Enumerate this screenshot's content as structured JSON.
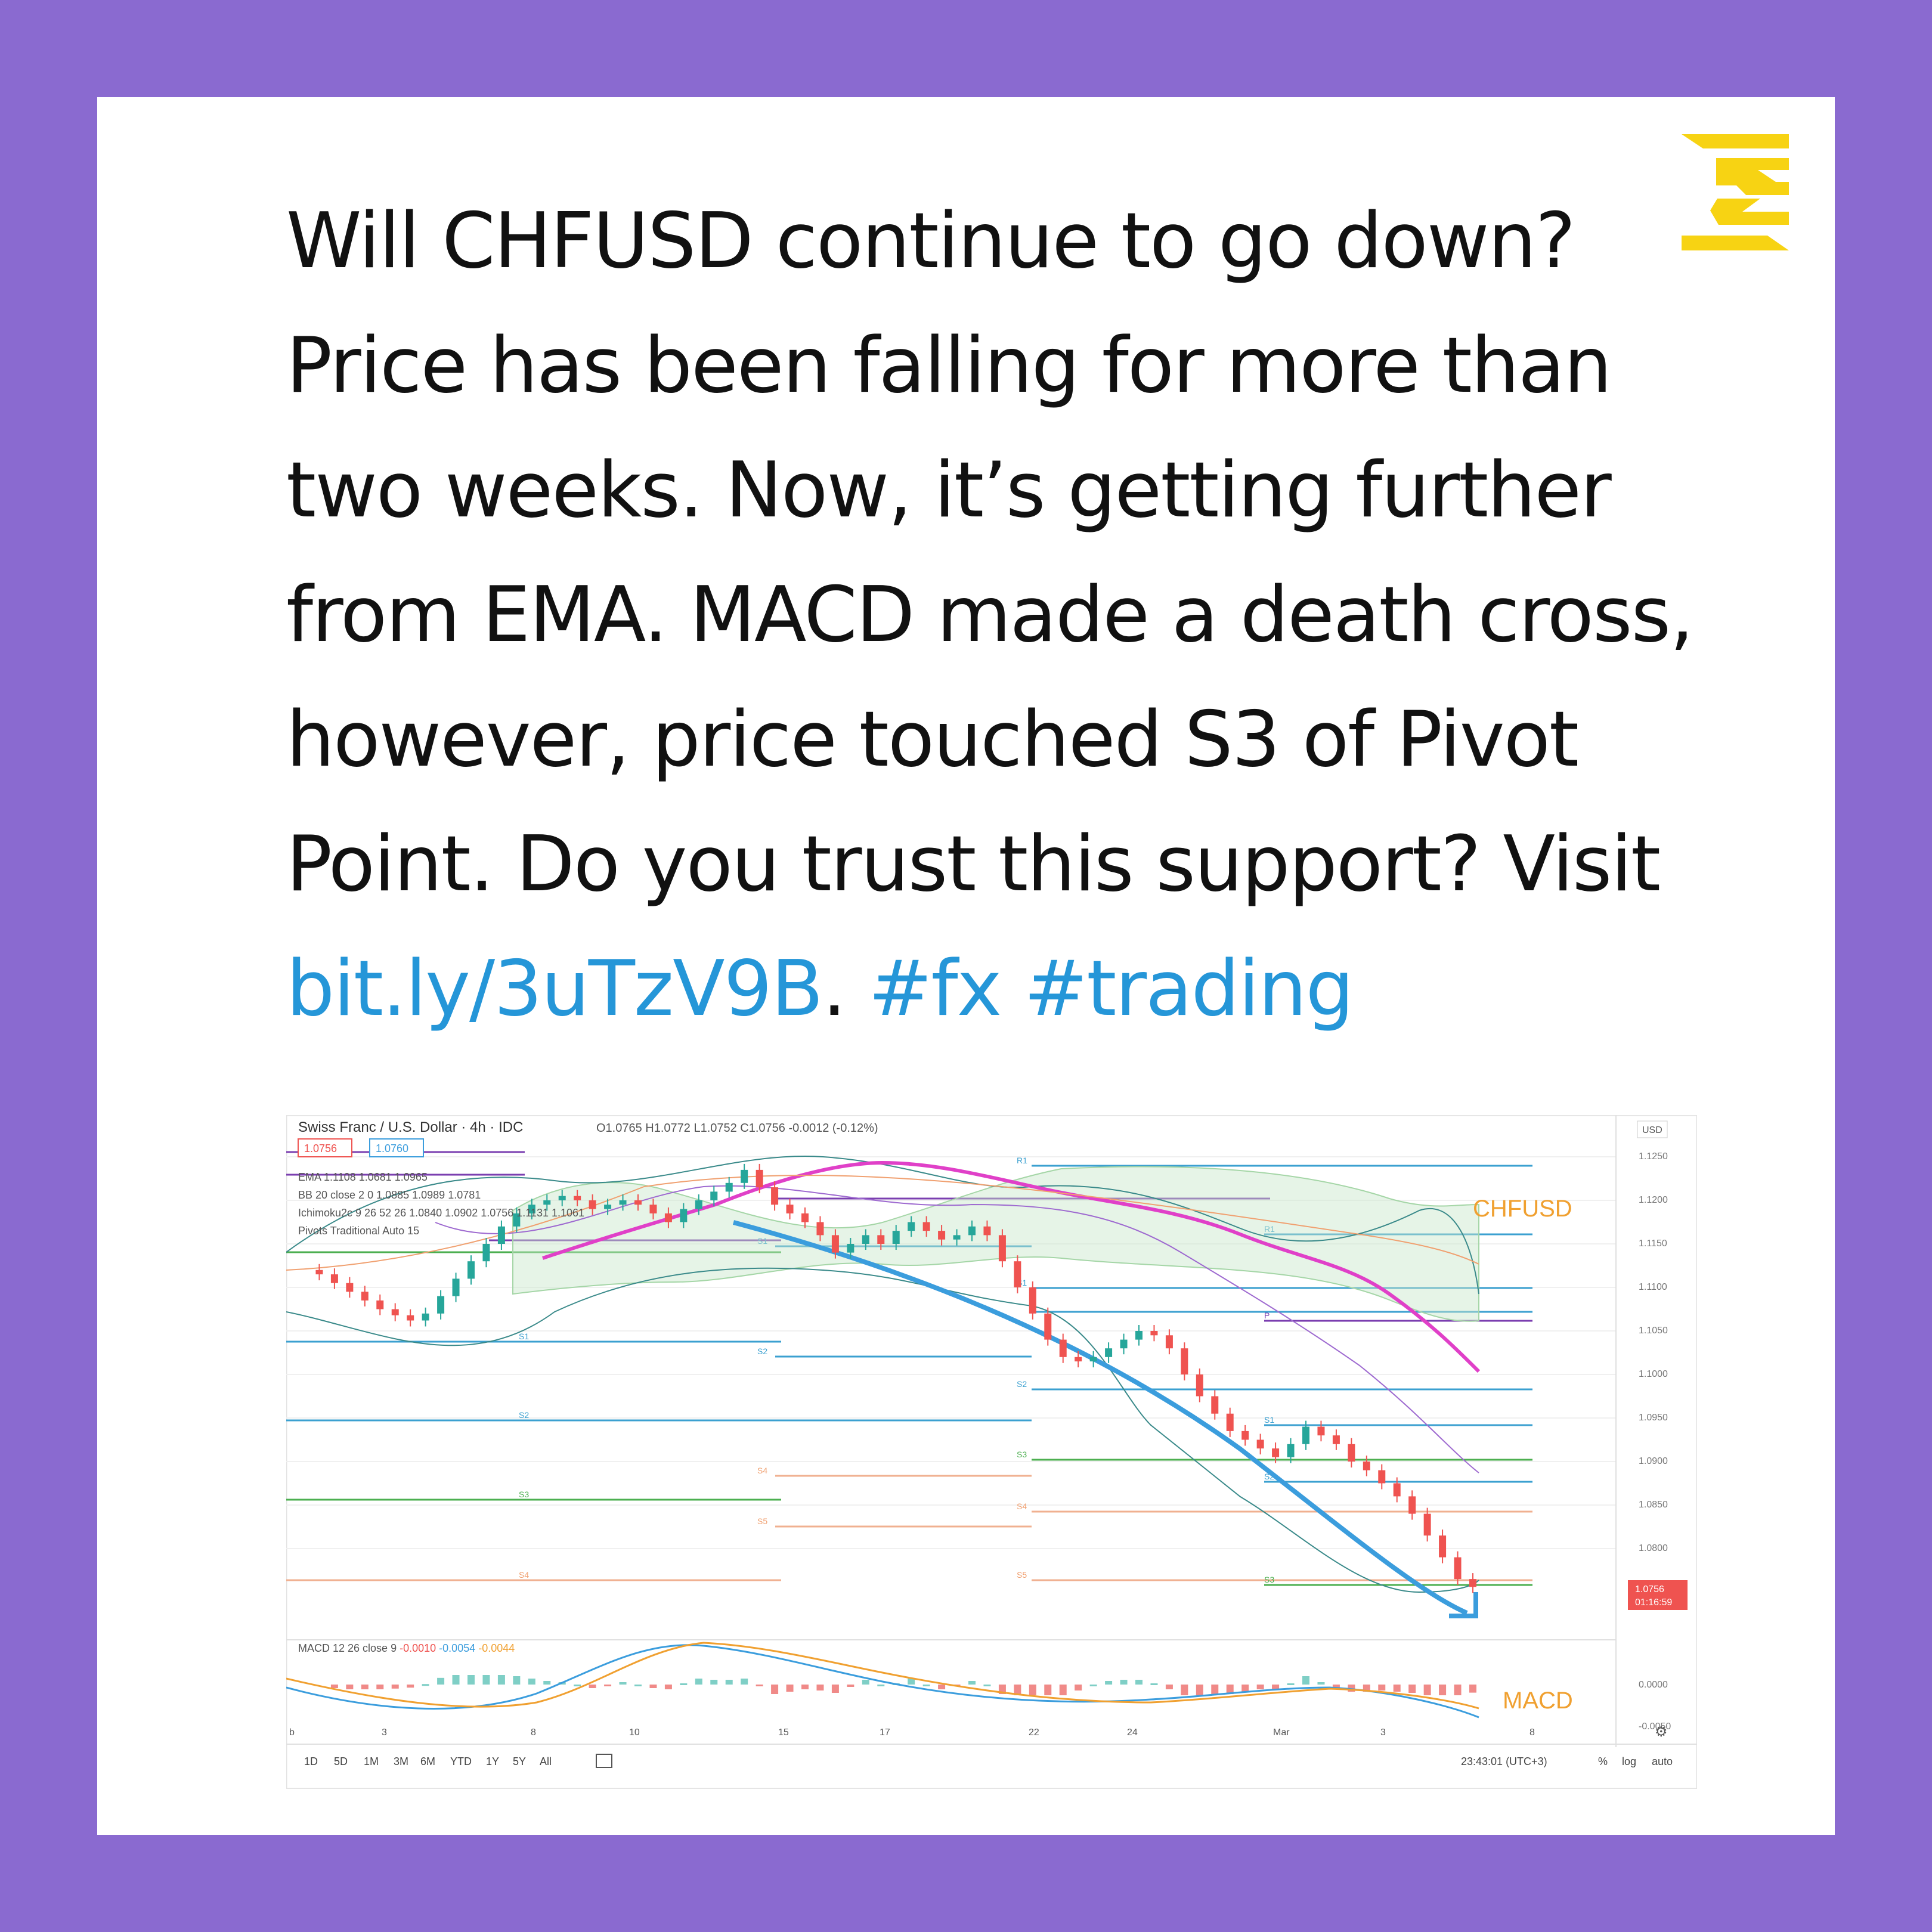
{
  "post": {
    "text_lines": [
      "Will CHFUSD continue to go down?",
      "Price has been falling for more than",
      "two weeks. Now, it’s getting further",
      "from EMA. MACD made a death cross,",
      "however, price touched S3 of Pivot",
      "Point. Do you trust this support? Visit"
    ],
    "link": "bit.ly/3uTzV9B",
    "after_link": ".",
    "hashtag_fx": "#fx",
    "hashtag_trading": "#trading"
  },
  "brand": {
    "logo_icon": "z-logo-icon",
    "accent": "#f7d313"
  },
  "colors": {
    "background": "#8a6ad0",
    "card": "#ffffff",
    "link": "#2596d8",
    "candle_up": "#26a69a",
    "candle_down": "#ef5350",
    "ema": "#e040c8",
    "trend_arrow": "#3b9ddd",
    "annotation": "#f0a030"
  },
  "chart": {
    "header": {
      "symbol": "Swiss Franc / U.S. Dollar",
      "interval": "4h",
      "source": "IDC",
      "ohlc": "O1.0765 H1.0772 L1.0752 C1.0756 -0.0012 (-0.12%)"
    },
    "price_box_left": "1.0756",
    "price_box_right": "1.0760",
    "indicators": [
      "EMA 1.1108 1.0681 1.0965",
      "BB 20 close 2 0 1.0885 1.0989 1.0781",
      "Ichimoku2c 9 26 52 26 1.0840 1.0902 1.0756 1.1131 1.1061",
      "Pivots Traditional Auto 15"
    ],
    "currency": "USD",
    "y_ticks": [
      "1.1250",
      "1.1200",
      "1.1150",
      "1.1100",
      "1.1050",
      "1.1000",
      "1.0950",
      "1.0900",
      "1.0850",
      "1.0800"
    ],
    "current_price": "1.0756",
    "countdown": "01:16:59",
    "annotation_price": "CHFUSD",
    "annotation_macd": "MACD",
    "macd_header": "MACD 12 26 close 9",
    "macd_hist": "-0.0010",
    "macd_line": "-0.0054",
    "macd_signal": "-0.0044",
    "macd_ticks": [
      "0.0000",
      "-0.0050"
    ],
    "x_ticks": [
      "b",
      "3",
      "8",
      "10",
      "15",
      "17",
      "22",
      "24",
      "Mar",
      "3",
      "8"
    ],
    "ranges": [
      "1D",
      "5D",
      "1M",
      "3M",
      "6M",
      "YTD",
      "1Y",
      "5Y",
      "All"
    ],
    "timestamp": "23:43:01 (UTC+3)",
    "bottom_options": [
      "%",
      "log",
      "auto"
    ],
    "pivot_labels": [
      "R1",
      "P",
      "S1",
      "S2",
      "S3",
      "S4",
      "S5"
    ],
    "close_series": [
      1.112,
      1.1115,
      1.1105,
      1.1095,
      1.1085,
      1.1075,
      1.1068,
      1.1062,
      1.107,
      1.109,
      1.111,
      1.113,
      1.115,
      1.117,
      1.1185,
      1.1195,
      1.12,
      1.1205,
      1.12,
      1.119,
      1.1195,
      1.12,
      1.1195,
      1.1185,
      1.1175,
      1.119,
      1.12,
      1.121,
      1.122,
      1.1235,
      1.1215,
      1.1195,
      1.1185,
      1.1175,
      1.116,
      1.114,
      1.115,
      1.116,
      1.115,
      1.1165,
      1.1175,
      1.1165,
      1.1155,
      1.116,
      1.117,
      1.116,
      1.113,
      1.11,
      1.107,
      1.104,
      1.102,
      1.1015,
      1.102,
      1.103,
      1.104,
      1.105,
      1.1045,
      1.103,
      1.1,
      1.0975,
      1.0955,
      1.0935,
      1.0925,
      1.0915,
      1.0905,
      1.092,
      1.094,
      1.093,
      1.092,
      1.09,
      1.089,
      1.0875,
      1.086,
      1.084,
      1.0815,
      1.079,
      1.0765,
      1.0756
    ]
  }
}
